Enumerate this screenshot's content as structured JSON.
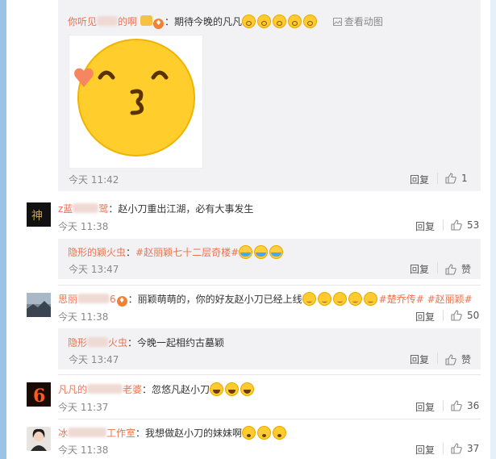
{
  "comment_top": {
    "user": "你听见",
    "user_end": "的啊",
    "text": "：期待今晚的凡凡",
    "view_image": "查看动图",
    "time": "今天 11:42",
    "reply": "回复",
    "likes": "1"
  },
  "comment_1": {
    "user": "z蓝",
    "user_end": "鹭",
    "text": "：赵小刀重出江湖，必有大事发生",
    "time": "今天 11:38",
    "reply": "回复",
    "likes": "53",
    "subreply": {
      "user": "隐形的颖火虫",
      "text": "：",
      "tag": "#赵丽颖七十二层奇楼#",
      "time": "今天 13:47",
      "reply": "回复",
      "likes": "赞"
    }
  },
  "comment_2": {
    "user": "思丽",
    "user_end": "6",
    "text": "：丽颖萌萌的，你的好友赵小刀已经上线",
    "tag1": "#楚乔传#",
    "tag2": "#赵丽颖#",
    "time": "今天 11:38",
    "reply": "回复",
    "likes": "50",
    "subreply": {
      "user": "隐形",
      "user_end": "火虫",
      "text": "：今晚一起相约古墓颖",
      "time": "今天 13:47",
      "reply": "回复",
      "likes": "赞"
    }
  },
  "comment_3": {
    "user": "凡凡的",
    "user_end": "老婆",
    "text": "：忽悠凡赵小刀",
    "time": "今天 11:37",
    "reply": "回复",
    "likes": "36"
  },
  "comment_4": {
    "user": "冰",
    "user_end": "工作室",
    "text": "：我想做赵小刀的妹妹啊",
    "time": "今天 11:38",
    "reply": "回复",
    "likes": "37"
  },
  "colors": {
    "username": "#eb7350",
    "emoji_yellow": "#ffcb2e",
    "heart": "#f5865f",
    "sub_bg": "#f2f2f5"
  },
  "icons": {
    "like": "thumbs-up-icon",
    "image": "picture-icon"
  }
}
